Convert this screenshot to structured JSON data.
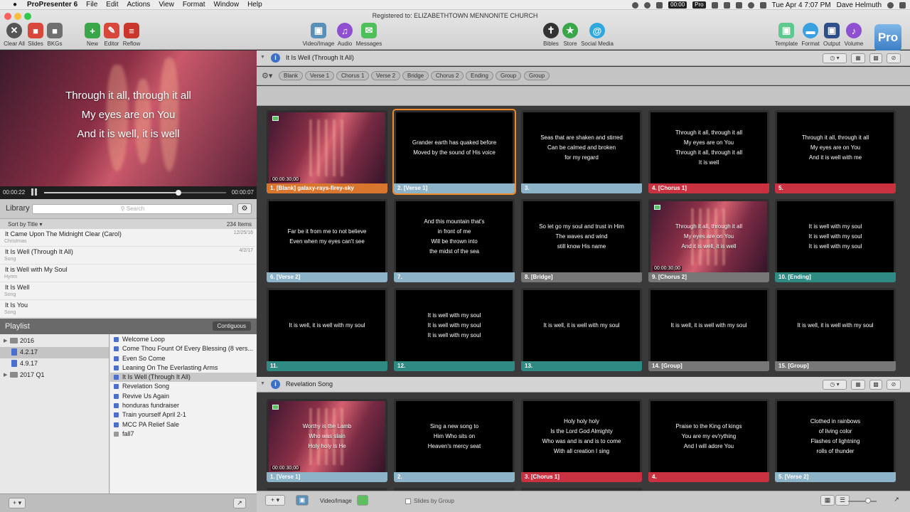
{
  "menubar": {
    "app": "ProPresenter 6",
    "items": [
      "File",
      "Edit",
      "Actions",
      "View",
      "Format",
      "Window",
      "Help"
    ],
    "battery_time": "00:00",
    "pro_badge": "Pro",
    "clock": "Tue Apr 4  7:07 PM",
    "user": "Dave Helmuth"
  },
  "toolbar": {
    "registered": "Registered to: ELIZABETHTOWN MENNONITE CHURCH",
    "left_buttons": [
      "Clear All",
      "Slides",
      "BKGs",
      "New",
      "Editor",
      "Reflow"
    ],
    "media_buttons": [
      "Video/Image",
      "Audio",
      "Messages"
    ],
    "center_buttons": [
      "Bibles",
      "Store",
      "Social Media"
    ],
    "right_buttons": [
      "Template",
      "Format",
      "Output",
      "Volume"
    ],
    "logo": "Pro"
  },
  "preview": {
    "lines": [
      "Through it all, through it all",
      "My eyes are on You",
      "And it is well, it is well"
    ],
    "elapsed": "00:00:22",
    "remaining": "00:00:07",
    "progress": 0.74
  },
  "library": {
    "title": "Library",
    "search_placeholder": "Search",
    "sort": "Sort by Title",
    "count": "234 Items",
    "items": [
      {
        "name": "It Came Upon The Midnight Clear (Carol)",
        "group": "Christmas",
        "date": "12/25/16"
      },
      {
        "name": "It Is Well (Through It All)",
        "group": "Song",
        "date": "4/2/17"
      },
      {
        "name": "It is Well with My Soul",
        "group": "Hymn",
        "date": ""
      },
      {
        "name": "It Is Well",
        "group": "Song",
        "date": ""
      },
      {
        "name": "It Is You",
        "group": "Song",
        "date": ""
      }
    ]
  },
  "playlist": {
    "title": "Playlist",
    "mode": "Contiguous",
    "tree": [
      {
        "label": "2016",
        "type": "folder"
      },
      {
        "label": "4.2.17",
        "type": "doc",
        "selected": true
      },
      {
        "label": "4.9.17",
        "type": "doc"
      },
      {
        "label": "2017 Q1",
        "type": "folder"
      }
    ],
    "items": [
      "Welcome Loop",
      "Come Thou Fount Of Every Blessing (8 vers...",
      "Even So Come",
      "Leaning On The Everlasting Arms",
      "It Is Well (Through It All)",
      "Revelation Song",
      "Revive Us Again",
      "honduras fundraiser",
      "Train yourself April 2-1",
      "MCC PA Relief Sale",
      "fall7"
    ],
    "selected_index": 4
  },
  "presentation1": {
    "title": "It Is Well (Through It All)",
    "groups": [
      "Blank",
      "Verse 1",
      "Chorus 1",
      "Verse 2",
      "Bridge",
      "Chorus 2",
      "Ending",
      "Group",
      "Group"
    ],
    "slides": [
      {
        "text": "",
        "label": "1. [Blank] galaxy-rays-firey-sky",
        "color": "#d9762e",
        "bg": true,
        "timecode": "00:00:30;00"
      },
      {
        "text": "Grander earth has quaked before\nMoved by the sound of His voice",
        "label": "2. [Verse 1]",
        "color": "#8db3c9",
        "selected": true
      },
      {
        "text": "Seas that are shaken and stirred\nCan be calmed and broken\nfor my regard",
        "label": "3.",
        "color": "#8db3c9"
      },
      {
        "text": "Through it all, through it all\nMy eyes are on You\nThrough it all, through it all\nIt is well",
        "label": "4. [Chorus 1]",
        "color": "#c93040"
      },
      {
        "text": "Through it all, through it all\nMy eyes are on You\nAnd it is well with me",
        "label": "5.",
        "color": "#c93040"
      },
      {
        "text": "Far be it from me to not believe\nEven when my eyes can't see",
        "label": "6. [Verse 2]",
        "color": "#8db3c9"
      },
      {
        "text": "And this mountain that's\nin front of me\nWill be thrown into\nthe midst of the sea",
        "label": "7.",
        "color": "#8db3c9"
      },
      {
        "text": "So let go my soul and trust in Him\nThe waves and wind\nstill know His name",
        "label": "8. [Bridge]",
        "color": "#777777"
      },
      {
        "text": "Through it all, through it all\nMy eyes are on You\nAnd it is well, it is well",
        "label": "9. [Chorus 2]",
        "color": "#777777",
        "bg": true,
        "timecode": "00:00:30;00"
      },
      {
        "text": "It is well with my soul\nIt is well with my soul\nIt is well with my soul",
        "label": "10. [Ending]",
        "color": "#2f8a84"
      },
      {
        "text": "It is well, it is well with my soul",
        "label": "11.",
        "color": "#2f8a84"
      },
      {
        "text": "It is well with my soul\nIt is well with my soul\nIt is well with my soul",
        "label": "12.",
        "color": "#2f8a84"
      },
      {
        "text": "It is well, it is well with my soul",
        "label": "13.",
        "color": "#2f8a84"
      },
      {
        "text": "It is well, it is well with my soul",
        "label": "14. [Group]",
        "color": "#777777"
      },
      {
        "text": "It is well, it is well with my soul",
        "label": "15. [Group]",
        "color": "#777777"
      }
    ]
  },
  "presentation2": {
    "title": "Revelation Song",
    "slides": [
      {
        "text": "Worthy is the Lamb\nWho was slain\nHoly holy is He",
        "label": "1. [Verse 1]",
        "color": "#8db3c9",
        "bg": true,
        "timecode": "00:00:30;00"
      },
      {
        "text": "Sing a new song to\nHim Who sits on\nHeaven's mercy seat",
        "label": "2.",
        "color": "#8db3c9"
      },
      {
        "text": "Holy holy holy\nIs the Lord God Almighty\nWho was and is and is to come\nWith all creation I sing",
        "label": "3. [Chorus 1]",
        "color": "#c93040"
      },
      {
        "text": "Praise to the King of kings\nYou are my ev'rything\nAnd I will adore You",
        "label": "4.",
        "color": "#c93040"
      },
      {
        "text": "Clothed in rainbows\nof living color\nFlashes of lightning\nrolls of thunder",
        "label": "5. [Verse 2]",
        "color": "#8db3c9"
      }
    ]
  },
  "footer": {
    "media_label": "Video/Image",
    "slides_by_group": "Slides by Group"
  }
}
